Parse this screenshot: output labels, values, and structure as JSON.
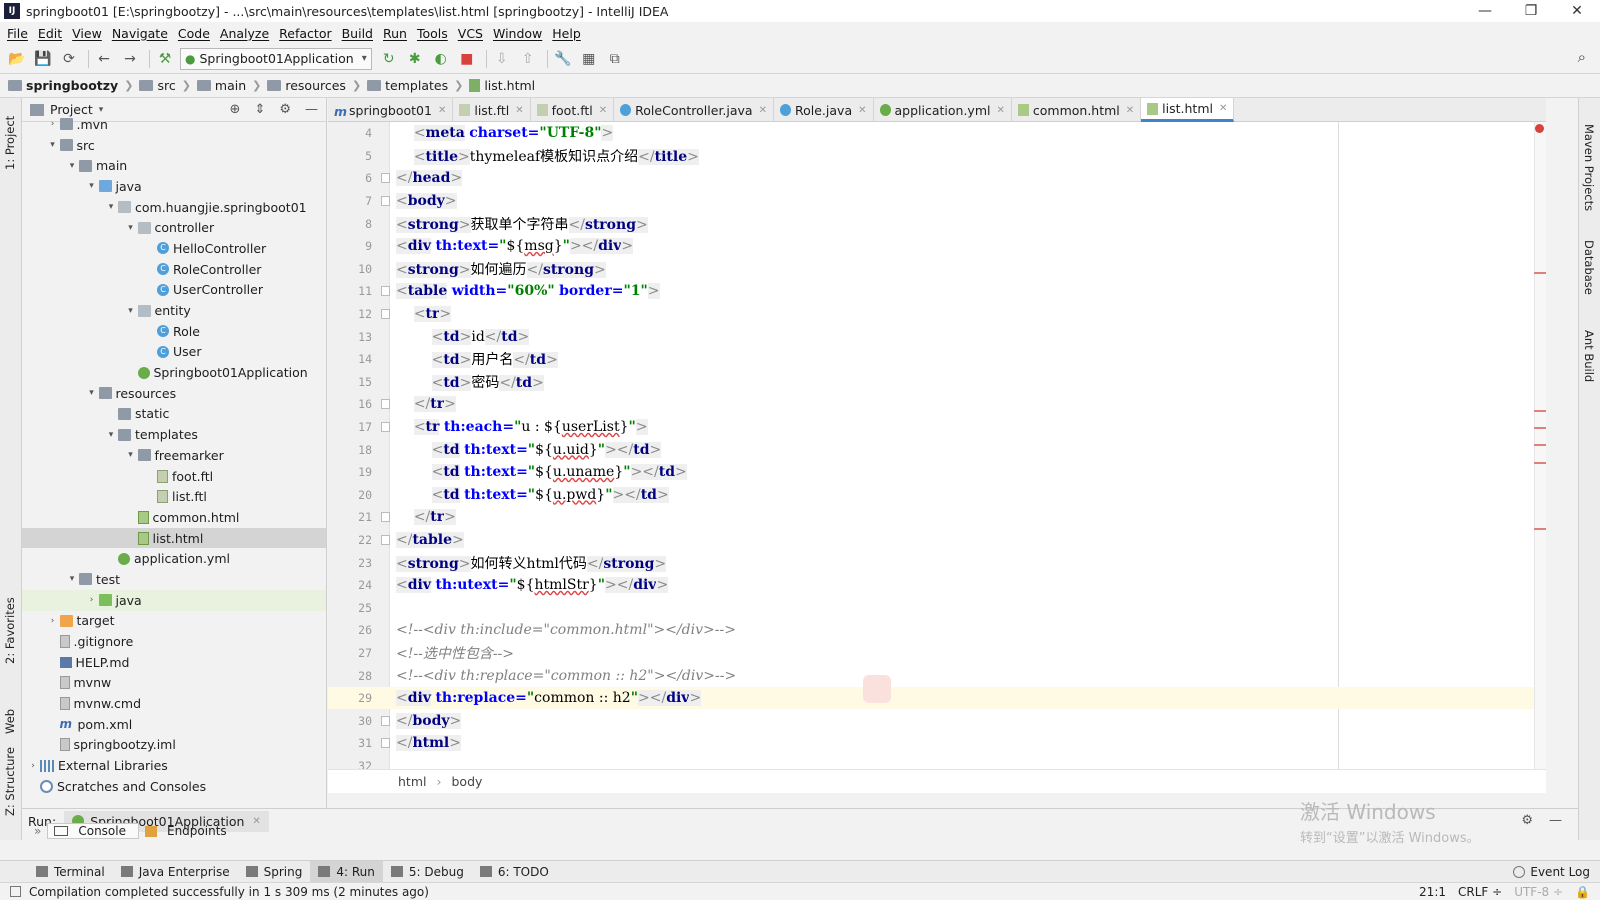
{
  "window": {
    "title": "springboot01 [E:\\springbootzy] - ...\\src\\main\\resources\\templates\\list.html [springbootzy] - IntelliJ IDEA",
    "minimize": "—",
    "restore": "❐",
    "close": "✕"
  },
  "menu": [
    "File",
    "Edit",
    "View",
    "Navigate",
    "Code",
    "Analyze",
    "Refactor",
    "Build",
    "Run",
    "Tools",
    "VCS",
    "Window",
    "Help"
  ],
  "toolbar": {
    "run_config": "Springboot01Application"
  },
  "breadcrumb": [
    "springbootzy",
    "src",
    "main",
    "resources",
    "templates",
    "list.html"
  ],
  "left_stripe": [
    "1: Project",
    "2: Favorites",
    "Web",
    "Z: Structure"
  ],
  "right_stripe": [
    "Maven Projects",
    "Database",
    "Ant Build"
  ],
  "project_panel": {
    "title": "Project",
    "tree": [
      {
        "label": ".mvn",
        "depth": 1,
        "arrow": "›",
        "icon": "folder"
      },
      {
        "label": "src",
        "depth": 1,
        "arrow": "⌄",
        "icon": "folder"
      },
      {
        "label": "main",
        "depth": 2,
        "arrow": "⌄",
        "icon": "folder"
      },
      {
        "label": "java",
        "depth": 3,
        "arrow": "⌄",
        "icon": "folder-blue"
      },
      {
        "label": "com.huangjie.springboot01",
        "depth": 4,
        "arrow": "⌄",
        "icon": "pkg"
      },
      {
        "label": "controller",
        "depth": 5,
        "arrow": "⌄",
        "icon": "pkg"
      },
      {
        "label": "HelloController",
        "depth": 6,
        "arrow": "",
        "icon": "class"
      },
      {
        "label": "RoleController",
        "depth": 6,
        "arrow": "",
        "icon": "class"
      },
      {
        "label": "UserController",
        "depth": 6,
        "arrow": "",
        "icon": "class"
      },
      {
        "label": "entity",
        "depth": 5,
        "arrow": "⌄",
        "icon": "pkg"
      },
      {
        "label": "Role",
        "depth": 6,
        "arrow": "",
        "icon": "class"
      },
      {
        "label": "User",
        "depth": 6,
        "arrow": "",
        "icon": "class"
      },
      {
        "label": "Springboot01Application",
        "depth": 5,
        "arrow": "",
        "icon": "spring"
      },
      {
        "label": "resources",
        "depth": 3,
        "arrow": "⌄",
        "icon": "folder"
      },
      {
        "label": "static",
        "depth": 4,
        "arrow": "",
        "icon": "folder"
      },
      {
        "label": "templates",
        "depth": 4,
        "arrow": "⌄",
        "icon": "folder"
      },
      {
        "label": "freemarker",
        "depth": 5,
        "arrow": "⌄",
        "icon": "folder"
      },
      {
        "label": "foot.ftl",
        "depth": 6,
        "arrow": "",
        "icon": "ftl"
      },
      {
        "label": "list.ftl",
        "depth": 6,
        "arrow": "",
        "icon": "ftl"
      },
      {
        "label": "common.html",
        "depth": 5,
        "arrow": "",
        "icon": "html"
      },
      {
        "label": "list.html",
        "depth": 5,
        "arrow": "",
        "icon": "html",
        "selected": true
      },
      {
        "label": "application.yml",
        "depth": 4,
        "arrow": "",
        "icon": "yml"
      },
      {
        "label": "test",
        "depth": 2,
        "arrow": "⌄",
        "icon": "folder"
      },
      {
        "label": "java",
        "depth": 3,
        "arrow": "›",
        "icon": "folder-green",
        "highlight": true
      },
      {
        "label": "target",
        "depth": 1,
        "arrow": "›",
        "icon": "folder-orange"
      },
      {
        "label": ".gitignore",
        "depth": 1,
        "arrow": "",
        "icon": "txt"
      },
      {
        "label": "HELP.md",
        "depth": 1,
        "arrow": "",
        "icon": "md"
      },
      {
        "label": "mvnw",
        "depth": 1,
        "arrow": "",
        "icon": "txt"
      },
      {
        "label": "mvnw.cmd",
        "depth": 1,
        "arrow": "",
        "icon": "txt"
      },
      {
        "label": "pom.xml",
        "depth": 1,
        "arrow": "",
        "icon": "maven"
      },
      {
        "label": "springbootzy.iml",
        "depth": 1,
        "arrow": "",
        "icon": "txt"
      },
      {
        "label": "External Libraries",
        "depth": 0,
        "arrow": "›",
        "icon": "lib"
      },
      {
        "label": "Scratches and Consoles",
        "depth": 0,
        "arrow": "",
        "icon": "scratch"
      }
    ]
  },
  "tabs": [
    {
      "label": "springboot01",
      "icon": "maven",
      "active": false
    },
    {
      "label": "list.ftl",
      "icon": "ftl",
      "active": false
    },
    {
      "label": "foot.ftl",
      "icon": "ftl",
      "active": false
    },
    {
      "label": "RoleController.java",
      "icon": "class",
      "active": false
    },
    {
      "label": "Role.java",
      "icon": "class",
      "active": false
    },
    {
      "label": "application.yml",
      "icon": "yml",
      "active": false
    },
    {
      "label": "common.html",
      "icon": "html",
      "active": false
    },
    {
      "label": "list.html",
      "icon": "html",
      "active": true
    }
  ],
  "editor": {
    "current_line": 29,
    "lines": [
      {
        "n": "4",
        "html": "    <span class='br'>&lt;</span><span class='tg'>meta</span> <span class='at'>charset=</span><span class='av'>\"UTF-8\"</span><span class='br'>&gt;</span>"
      },
      {
        "n": "5",
        "html": "    <span class='br'>&lt;</span><span class='tg'>title</span><span class='br'>&gt;</span>thymeleaf模板知识点介绍<span class='br'>&lt;/</span><span class='tg'>title</span><span class='br'>&gt;</span>"
      },
      {
        "n": "6",
        "fold": true,
        "html": "<span class='br'>&lt;/</span><span class='tg'>head</span><span class='br'>&gt;</span>"
      },
      {
        "n": "7",
        "fold": true,
        "html": "<span class='br'>&lt;</span><span class='tg'>body</span><span class='br'>&gt;</span>"
      },
      {
        "n": "8",
        "html": "<span class='br'>&lt;</span><span class='tg'>strong</span><span class='br'>&gt;</span>获取单个字符串<span class='br'>&lt;/</span><span class='tg'>strong</span><span class='br'>&gt;</span>"
      },
      {
        "n": "9",
        "html": "<span class='br'>&lt;</span><span class='tg'>div</span> <span class='at'>th:text=</span><span class='av'>\"</span>${<span class='sq'>msg</span>}<span class='av'>\"</span><span class='br'>&gt;&lt;/</span><span class='tg'>div</span><span class='br'>&gt;</span>"
      },
      {
        "n": "10",
        "html": "<span class='br'>&lt;</span><span class='tg'>strong</span><span class='br'>&gt;</span>如何遍历<span class='br'>&lt;/</span><span class='tg'>strong</span><span class='br'>&gt;</span>"
      },
      {
        "n": "11",
        "fold": true,
        "html": "<span class='br'>&lt;</span><span class='tg'>table</span> <span class='at'>width=</span><span class='av'>\"60%\"</span> <span class='at'>border=</span><span class='av'>\"1\"</span><span class='br'>&gt;</span>"
      },
      {
        "n": "12",
        "fold": true,
        "html": "    <span class='br'>&lt;</span><span class='tg'>tr</span><span class='br'>&gt;</span>"
      },
      {
        "n": "13",
        "html": "        <span class='br'>&lt;</span><span class='tg'>td</span><span class='br'>&gt;</span>id<span class='br'>&lt;/</span><span class='tg'>td</span><span class='br'>&gt;</span>"
      },
      {
        "n": "14",
        "html": "        <span class='br'>&lt;</span><span class='tg'>td</span><span class='br'>&gt;</span>用户名<span class='br'>&lt;/</span><span class='tg'>td</span><span class='br'>&gt;</span>"
      },
      {
        "n": "15",
        "html": "        <span class='br'>&lt;</span><span class='tg'>td</span><span class='br'>&gt;</span>密码<span class='br'>&lt;/</span><span class='tg'>td</span><span class='br'>&gt;</span>"
      },
      {
        "n": "16",
        "fold": true,
        "html": "    <span class='br'>&lt;/</span><span class='tg'>tr</span><span class='br'>&gt;</span>"
      },
      {
        "n": "17",
        "fold": true,
        "html": "    <span class='br'>&lt;</span><span class='tg'>tr</span> <span class='at'>th:each=</span><span class='av'>\"</span>u : ${<span class='sq'>userList</span>}<span class='av'>\"</span><span class='br'>&gt;</span>"
      },
      {
        "n": "18",
        "html": "        <span class='br'>&lt;</span><span class='tg'>td</span> <span class='at'>th:text=</span><span class='av'>\"</span>${<span class='sq'>u.uid</span>}<span class='av'>\"</span><span class='br'>&gt;&lt;/</span><span class='tg'>td</span><span class='br'>&gt;</span>"
      },
      {
        "n": "19",
        "html": "        <span class='br'>&lt;</span><span class='tg'>td</span> <span class='at'>th:text=</span><span class='av'>\"</span>${<span class='sq'>u.uname</span>}<span class='av'>\"</span><span class='br'>&gt;&lt;/</span><span class='tg'>td</span><span class='br'>&gt;</span>"
      },
      {
        "n": "20",
        "html": "        <span class='br'>&lt;</span><span class='tg'>td</span> <span class='at'>th:text=</span><span class='av'>\"</span>${<span class='sq'>u.pwd</span>}<span class='av'>\"</span><span class='br'>&gt;&lt;/</span><span class='tg'>td</span><span class='br'>&gt;</span>"
      },
      {
        "n": "21",
        "fold": true,
        "html": "    <span class='br'>&lt;/</span><span class='tg'>tr</span><span class='br'>&gt;</span>"
      },
      {
        "n": "22",
        "fold": true,
        "html": "<span class='br'>&lt;/</span><span class='tg'>table</span><span class='br'>&gt;</span>"
      },
      {
        "n": "23",
        "html": "<span class='br'>&lt;</span><span class='tg'>strong</span><span class='br'>&gt;</span>如何转义html代码<span class='br'>&lt;/</span><span class='tg'>strong</span><span class='br'>&gt;</span>"
      },
      {
        "n": "24",
        "html": "<span class='br'>&lt;</span><span class='tg'>div</span> <span class='at'>th:utext=</span><span class='av'>\"</span>${<span class='sq'>htmlStr</span>}<span class='av'>\"</span><span class='br'>&gt;&lt;/</span><span class='tg'>div</span><span class='br'>&gt;</span>"
      },
      {
        "n": "25",
        "html": ""
      },
      {
        "n": "26",
        "html": "<span class='cm'>&lt;!--&lt;div th:include=\"common.html\"&gt;&lt;/div&gt;--&gt;</span>"
      },
      {
        "n": "27",
        "html": "<span class='cm'>&lt;!--选中性包含--&gt;</span>"
      },
      {
        "n": "28",
        "html": "<span class='cm'>&lt;!--&lt;div th:replace=\"common :: h2\"&gt;&lt;/div&gt;--&gt;</span>"
      },
      {
        "n": "29",
        "html": "<span class='match'><span class='br'>&lt;</span><span class='tg'>div</span></span> <span class='at'>th:replace=</span><span class='av'>\"</span>common :: h2<span class='av'>\"</span><span class='br'>&gt;</span><span class='match'><span class='br'>&lt;/</span><span class='tg'>div</span><span class='br'>&gt;</span></span>"
      },
      {
        "n": "30",
        "fold": true,
        "html": "<span class='br'>&lt;/</span><span class='tg'>body</span><span class='br'>&gt;</span>"
      },
      {
        "n": "31",
        "fold": true,
        "html": "<span class='br'>&lt;/</span><span class='tg'>html</span><span class='br'>&gt;</span>"
      },
      {
        "n": "32",
        "html": ""
      }
    ],
    "breadcrumb": [
      "html",
      "body"
    ]
  },
  "run_panel": {
    "label": "Run:",
    "config_tab": "Springboot01Application",
    "subtabs": [
      "Console",
      "Endpoints"
    ]
  },
  "watermark": {
    "line1": "激活 Windows",
    "line2": "转到“设置”以激活 Windows。"
  },
  "bottom_tools": [
    {
      "label": "Terminal",
      "active": false
    },
    {
      "label": "Java Enterprise",
      "active": false
    },
    {
      "label": "Spring",
      "active": false
    },
    {
      "label": "4: Run",
      "active": true
    },
    {
      "label": "5: Debug",
      "active": false
    },
    {
      "label": "6: TODO",
      "active": false
    }
  ],
  "event_log": "Event Log",
  "status": {
    "message": "Compilation completed successfully in 1 s 309 ms (2 minutes ago)",
    "position": "21:1",
    "line_sep": "CRLF ÷",
    "encoding": "UTF-8 ÷"
  },
  "colors": {
    "accent": "#4083c9",
    "tag": "#000080",
    "attr": "#0000ff",
    "value": "#008000",
    "comment": "#808080",
    "current_line": "#fffae3"
  }
}
